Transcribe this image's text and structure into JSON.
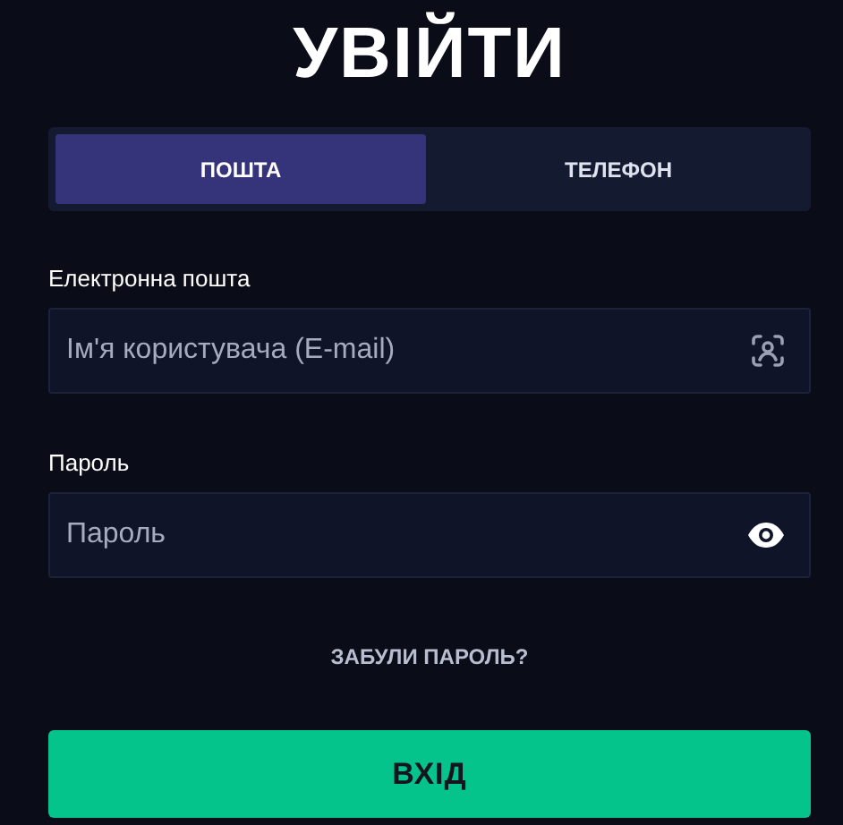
{
  "title": "УВІЙТИ",
  "tabs": [
    {
      "label": "ПОШТА",
      "selected": true
    },
    {
      "label": "ТЕЛЕФОН",
      "selected": false
    }
  ],
  "fields": [
    {
      "kind": "email",
      "label": "Електронна пошта",
      "placeholder": "Ім'я користувача (E-mail)"
    },
    {
      "kind": "password",
      "label": "Пароль",
      "placeholder": "Пароль"
    }
  ],
  "forgot_link": "ЗАБУЛИ ПАРОЛЬ?",
  "submit_button": "ВХІД"
}
